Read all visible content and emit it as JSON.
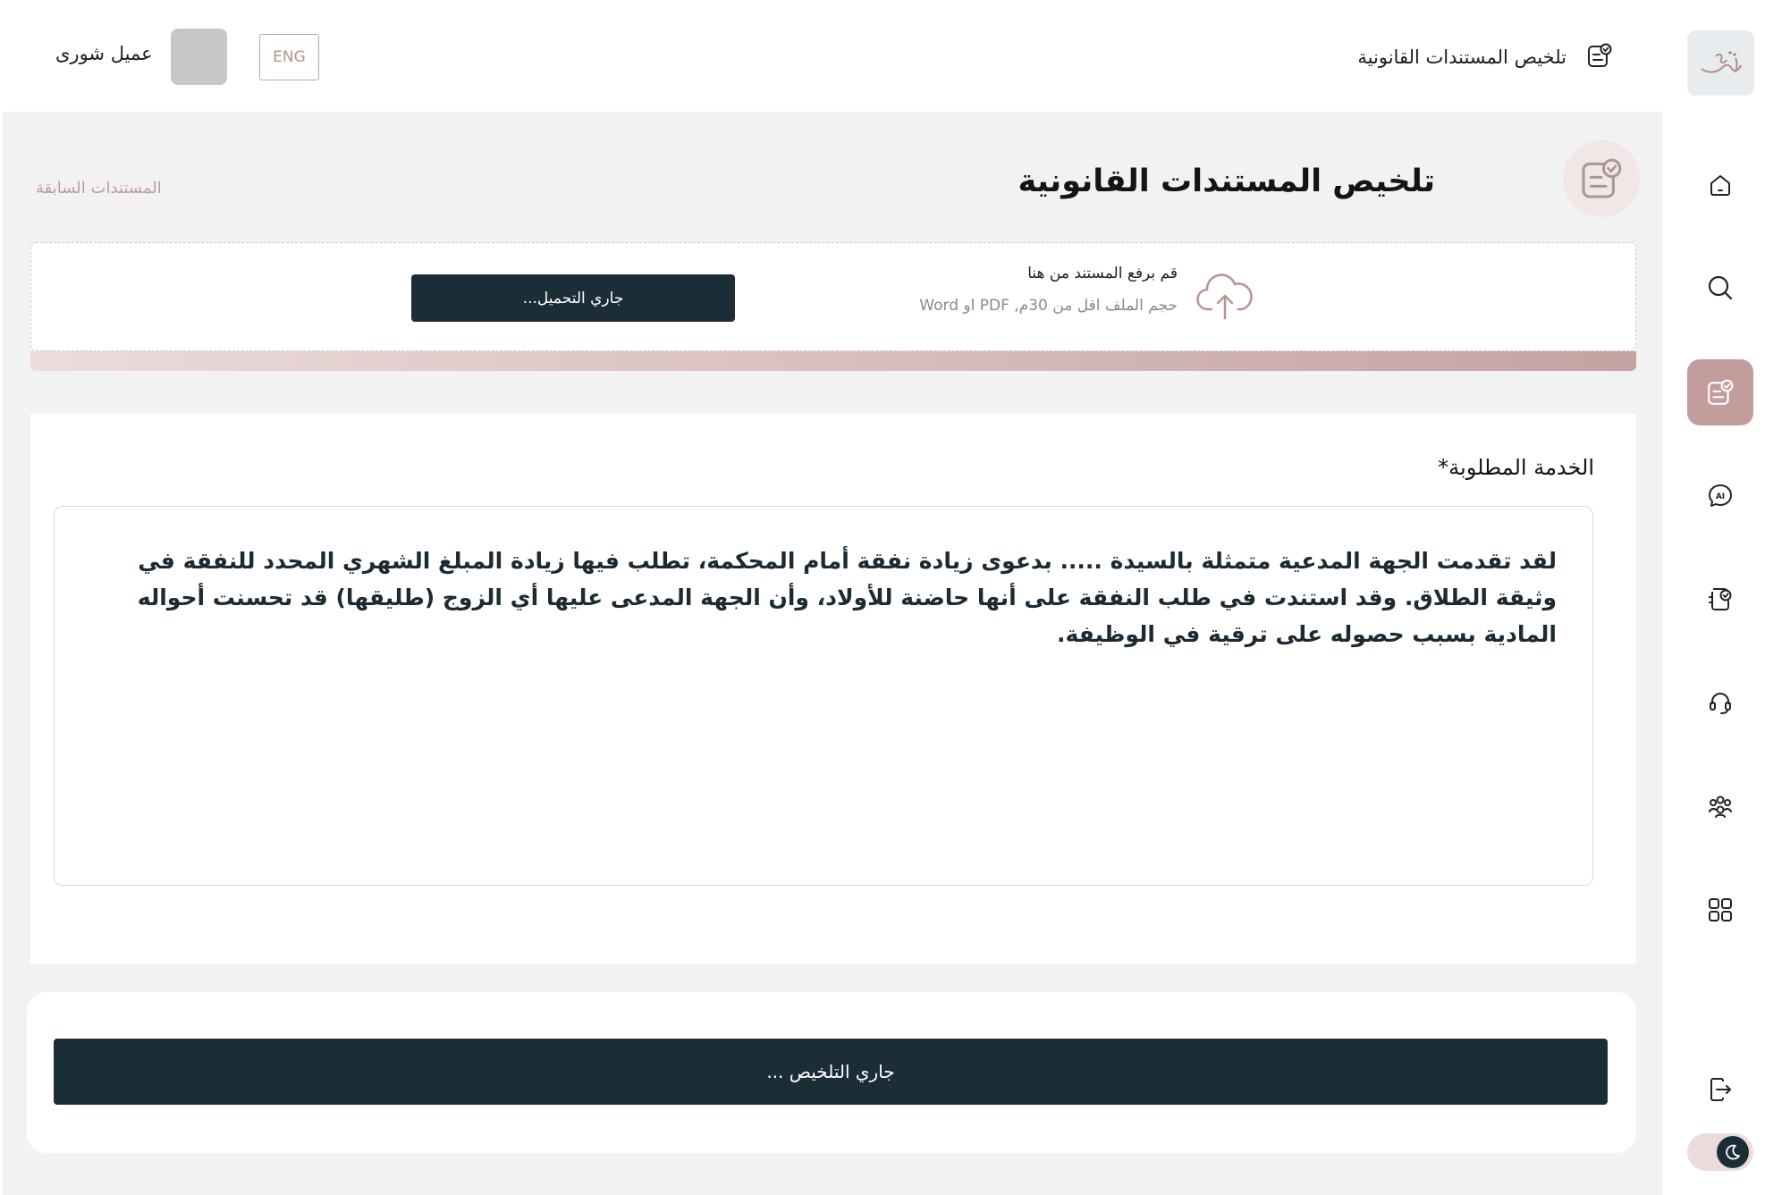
{
  "header": {
    "title": "تلخيص المستندات القانونية",
    "user_name": "عميل شورى",
    "lang_button": "ENG"
  },
  "sidebar": {
    "items": [
      {
        "icon": "home-icon"
      },
      {
        "icon": "search-icon"
      },
      {
        "icon": "document-check-icon",
        "active": true
      },
      {
        "icon": "ai-chat-icon"
      },
      {
        "icon": "contract-icon"
      },
      {
        "icon": "headset-icon"
      },
      {
        "icon": "community-icon"
      },
      {
        "icon": "grid-icon"
      },
      {
        "icon": "logout-icon"
      }
    ],
    "theme_toggle": "dark-mode-toggle"
  },
  "main": {
    "page_title": "تلخيص المستندات القانونية",
    "prev_docs_link": "المستندات السابقة",
    "upload": {
      "title": "قم برفع المستند من هنا",
      "hint": "حجم الملف اقل من 30م, PDF او Word",
      "button": "جاري التحميل..."
    },
    "service": {
      "label": "الخدمة المطلوبة*",
      "text": "لقد تقدمت الجهة المدعية متمثلة بالسيدة ..... بدعوى زيادة نفقة أمام المحكمة، تطلب فيها زيادة المبلغ الشهري المحدد للنفقة في وثيقة الطلاق. وقد استندت في طلب النفقة على أنها حاضنة للأولاد، وأن الجهة المدعى عليها أي الزوج (طليقها) قد تحسنت أحواله المادية بسبب حصوله على ترقية في الوظيفة."
    },
    "submit_button": "جاري التلخيص ..."
  },
  "colors": {
    "primary_dark": "#1b2e38",
    "accent_rose": "#c29d9b",
    "background": "#f2f2f2"
  }
}
